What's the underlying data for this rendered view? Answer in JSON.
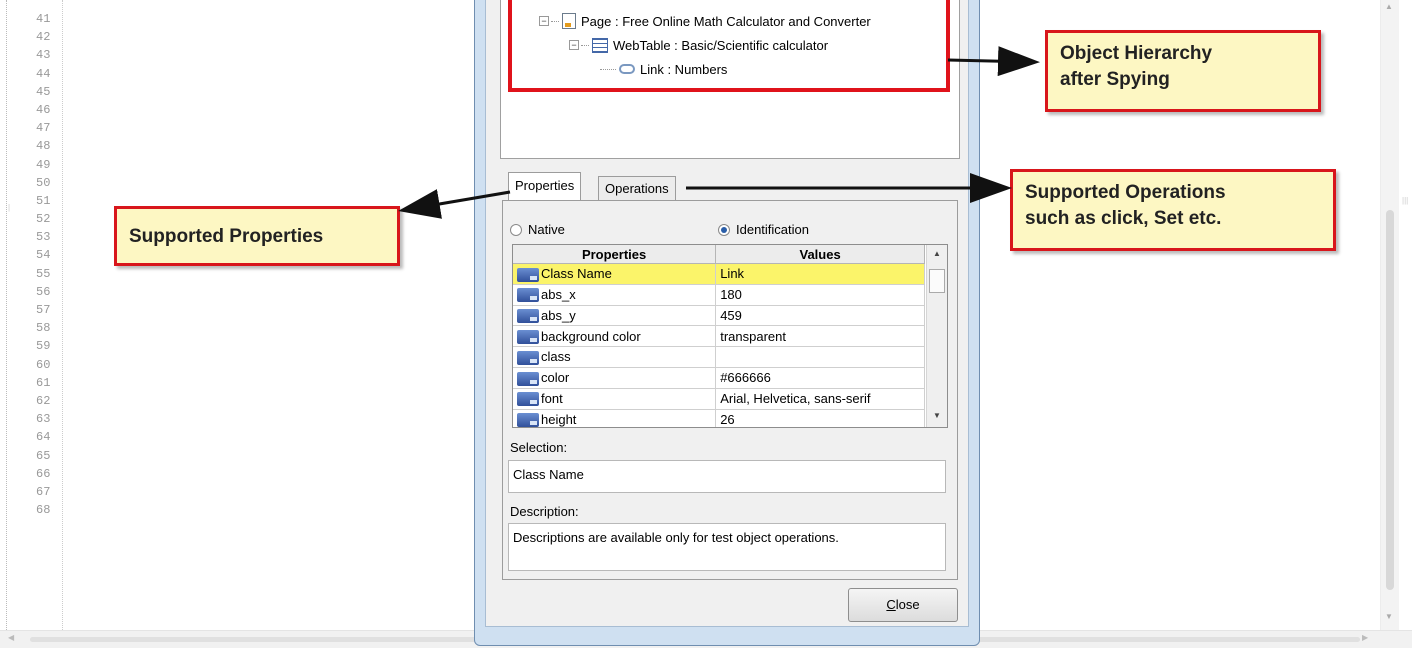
{
  "editor": {
    "line_numbers": [
      "41",
      "42",
      "43",
      "44",
      "45",
      "46",
      "47",
      "48",
      "49",
      "50",
      "51",
      "52",
      "53",
      "54",
      "55",
      "56",
      "57",
      "58",
      "59",
      "60",
      "61",
      "62",
      "63",
      "64",
      "65",
      "66",
      "67",
      "68"
    ]
  },
  "tree": {
    "page": "Page : Free Online Math Calculator and Converter",
    "webtable": "WebTable : Basic/Scientific calculator",
    "link": "Link : Numbers"
  },
  "tabs": {
    "properties": "Properties",
    "operations": "Operations"
  },
  "radios": {
    "native": "Native",
    "identification": "Identification",
    "selected": "identification"
  },
  "grid": {
    "headers": {
      "properties": "Properties",
      "values": "Values"
    },
    "rows": [
      {
        "property": "Class Name",
        "value": "Link"
      },
      {
        "property": "abs_x",
        "value": "180"
      },
      {
        "property": "abs_y",
        "value": "459"
      },
      {
        "property": "background color",
        "value": "transparent"
      },
      {
        "property": "class",
        "value": ""
      },
      {
        "property": "color",
        "value": "#666666"
      },
      {
        "property": "font",
        "value": "Arial, Helvetica, sans-serif"
      },
      {
        "property": "height",
        "value": "26"
      }
    ]
  },
  "selection": {
    "label": "Selection:",
    "value": "Class Name"
  },
  "description": {
    "label": "Description:",
    "value": "Descriptions are available only for test object operations."
  },
  "close_button": {
    "label_prefix": "",
    "accesskey": "C",
    "label_rest": "lose"
  },
  "callouts": {
    "hierarchy": [
      "Object Hierarchy",
      "after Spying"
    ],
    "properties": "Supported Properties",
    "operations": [
      "Supported Operations",
      "such as click, Set etc."
    ]
  },
  "colors": {
    "callout_fill": "#fdf7c3",
    "callout_border": "#d8161b",
    "selected_row": "#fbf46a"
  }
}
